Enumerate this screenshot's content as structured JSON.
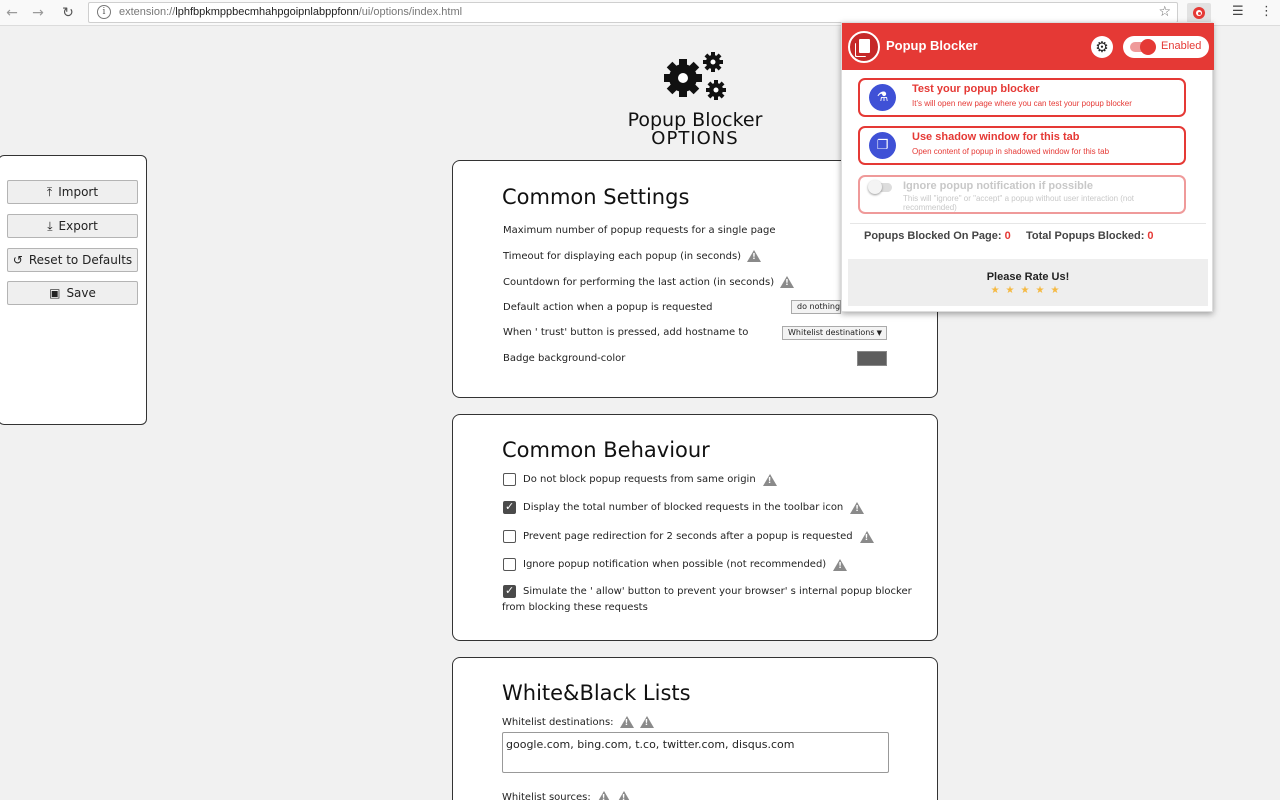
{
  "browser": {
    "url_prefix": "extension://",
    "url_host": "lphfbpkmppbecmhahpgoipnlabppfonn",
    "url_path": "/ui/options/index.html",
    "back_icon": "arrow-left-icon",
    "forward_icon": "arrow-right-icon",
    "reload_icon": "reload-icon"
  },
  "logo": {
    "title_line1": "Popup Blocker",
    "title_line2": "OPTIONS"
  },
  "sidebar": {
    "import_label": "Import",
    "export_label": "Export",
    "reset_label": "Reset to Defaults",
    "save_label": "Save"
  },
  "common_settings": {
    "title": "Common Settings",
    "max_requests_label": "Maximum number of popup requests for a single page",
    "timeout_label": "Timeout for displaying each popup (in seconds)",
    "countdown_label": "Countdown for performing the last action (in seconds)",
    "default_action_label": "Default action when a popup is requested",
    "default_action_value": "do nothing",
    "trust_label": "When ' trust'  button is pressed, add hostname to",
    "trust_value": "Whitelist destinations",
    "badge_label": "Badge background-color",
    "badge_color": "#5e5e5e"
  },
  "common_behaviour": {
    "title": "Common Behaviour",
    "items": [
      {
        "label": "Do not block popup requests from same origin",
        "checked": false
      },
      {
        "label": "Display the total number of blocked requests in the toolbar icon",
        "checked": true
      },
      {
        "label": "Prevent page redirection for 2 seconds after a popup is requested",
        "checked": false
      },
      {
        "label": "Ignore popup notification when possible (not recommended)",
        "checked": false
      },
      {
        "label": "Simulate the ' allow'  button to prevent your browser' s internal popup blocker",
        "label2": "from blocking these requests",
        "checked": true
      }
    ]
  },
  "lists": {
    "title": "White&Black Lists",
    "whitelist_dest_label": "Whitelist destinations:",
    "whitelist_dest_value": "google.com, bing.com, t.co, twitter.com, disqus.com",
    "whitelist_src_label": "Whitelist sources:"
  },
  "popup": {
    "title": "Popup Blocker",
    "toggle_label": "Enabled",
    "options": [
      {
        "title": "Test your popup blocker",
        "desc": "It's will open new page where you can test your popup blocker",
        "icon": "flask-icon"
      },
      {
        "title": "Use shadow window for this tab",
        "desc": "Open content of popup in shadowed window for this tab",
        "icon": "windows-icon"
      },
      {
        "title": "Ignore popup notification if possible",
        "desc": "This will \"ignore\" or \"accept\" a popup without user interaction (not recommended)",
        "icon": "toggle-icon"
      }
    ],
    "stats_page_label": "Popups Blocked On Page:",
    "stats_page_value": "0",
    "stats_total_label": "Total Popups Blocked:",
    "stats_total_value": "0",
    "rate_label": "Please Rate Us!",
    "stars": "★★★★★",
    "accent_color": "#e53935"
  }
}
